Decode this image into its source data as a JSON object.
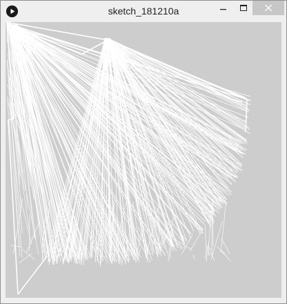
{
  "window": {
    "title": "sketch_181210a",
    "app_icon": "processing-play-icon",
    "controls": {
      "minimize_icon": "minimize-icon",
      "maximize_icon": "maximize-icon",
      "close_icon": "close-icon"
    }
  },
  "sketch": {
    "background_color": "#cdcdcd",
    "stroke_color": "#ffffff",
    "hub_a_color": "#ffffff",
    "hub_b_color": "#ffffff"
  }
}
